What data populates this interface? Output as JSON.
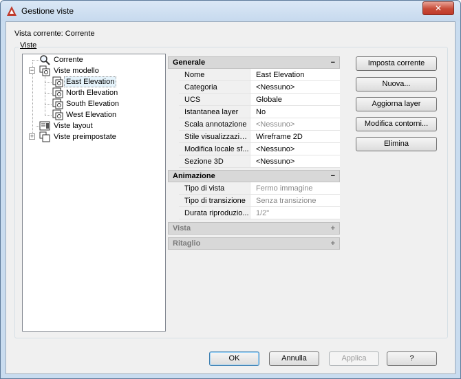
{
  "window": {
    "title": "Gestione viste",
    "close_glyph": "✕",
    "accent_color": "#c0392b"
  },
  "current_view_label": "Vista corrente: Corrente",
  "group_label": "Viste",
  "tree": {
    "items": [
      {
        "label": "Corrente",
        "icon": "magnifier-icon"
      },
      {
        "label": "Viste modello",
        "icon": "model-views-icon",
        "expander": "−"
      },
      {
        "label": "East Elevation",
        "icon": "view-icon",
        "selected": true
      },
      {
        "label": "North Elevation",
        "icon": "view-icon"
      },
      {
        "label": "South Elevation",
        "icon": "view-icon"
      },
      {
        "label": "West Elevation",
        "icon": "view-icon"
      },
      {
        "label": "Viste layout",
        "icon": "layout-views-icon"
      },
      {
        "label": "Viste preimpostate",
        "icon": "preset-views-icon",
        "expander": "+"
      }
    ]
  },
  "properties": {
    "general": {
      "title": "Generale",
      "toggle": "−",
      "rows": [
        {
          "name": "Nome",
          "value": "East Elevation"
        },
        {
          "name": "Categoria",
          "value": "<Nessuno>"
        },
        {
          "name": "UCS",
          "value": "Globale"
        },
        {
          "name": "Istantanea layer",
          "value": "No"
        },
        {
          "name": "Scala annotazione",
          "value": "<Nessuno>"
        },
        {
          "name": "Stile visualizzazio...",
          "value": "Wireframe 2D"
        },
        {
          "name": "Modifica locale sf...",
          "value": "<Nessuno>"
        },
        {
          "name": "Sezione 3D",
          "value": "<Nessuno>"
        }
      ]
    },
    "animation": {
      "title": "Animazione",
      "toggle": "−",
      "rows": [
        {
          "name": "Tipo di vista",
          "value": "Fermo immagine"
        },
        {
          "name": "Tipo di transizione",
          "value": "Senza transizione"
        },
        {
          "name": "Durata riproduzio...",
          "value": "1/2\""
        }
      ]
    },
    "view": {
      "title": "Vista",
      "toggle": "+"
    },
    "clip": {
      "title": "Ritaglio",
      "toggle": "+"
    }
  },
  "side_buttons": {
    "set_current": "Imposta corrente",
    "new": "Nuova...",
    "update_layers": "Aggiorna layer",
    "edit_boundaries": "Modifica contorni...",
    "delete": "Elimina"
  },
  "bottom_buttons": {
    "ok": "OK",
    "cancel": "Annulla",
    "apply": "Applica",
    "help": "?"
  }
}
